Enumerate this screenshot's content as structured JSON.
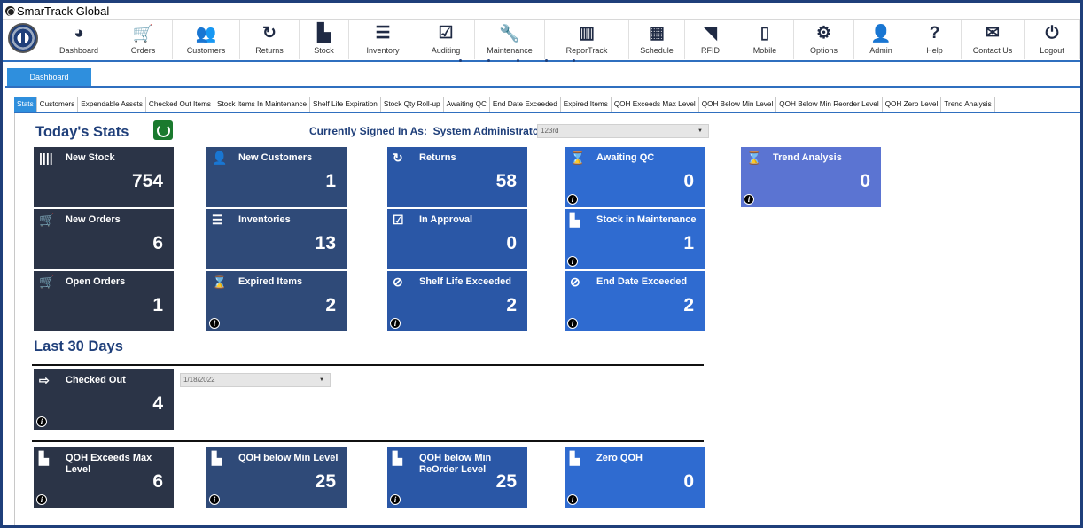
{
  "app": {
    "title": "SmarTrack Global"
  },
  "toolbar": {
    "items": [
      {
        "label": "Dashboard",
        "icon": "dashboard-icon",
        "glyph": "◕"
      },
      {
        "label": "Orders",
        "icon": "cart-icon",
        "glyph": "🛒"
      },
      {
        "label": "Customers",
        "icon": "users-icon",
        "glyph": "👥"
      },
      {
        "label": "Returns",
        "icon": "refresh-icon",
        "glyph": "↻"
      },
      {
        "label": "Stock",
        "icon": "stock-icon",
        "glyph": "▙"
      },
      {
        "label": "Inventory",
        "icon": "list-icon",
        "glyph": "☰"
      },
      {
        "label": "Auditing",
        "icon": "calendar-check-icon",
        "glyph": "☑"
      },
      {
        "label": "Maintenance",
        "icon": "wrench-icon",
        "glyph": "🔧"
      },
      {
        "label": "ReporTrack",
        "icon": "bar-chart-icon",
        "glyph": "▥"
      },
      {
        "label": "Schedule",
        "icon": "calendar-icon",
        "glyph": "▦"
      },
      {
        "label": "RFID",
        "icon": "rss-icon",
        "glyph": "◥"
      },
      {
        "label": "Mobile",
        "icon": "mobile-icon",
        "glyph": "▯"
      },
      {
        "label": "Options",
        "icon": "gears-icon",
        "glyph": "⚙"
      },
      {
        "label": "Admin",
        "icon": "user-icon",
        "glyph": "👤"
      },
      {
        "label": "Help",
        "icon": "help-icon",
        "glyph": "?"
      },
      {
        "label": "Contact Us",
        "icon": "envelope-icon",
        "glyph": "✉"
      },
      {
        "label": "Logout",
        "icon": "power-icon",
        "glyph": "⏻"
      }
    ]
  },
  "main_tab": "Dashboard",
  "subtabs": [
    "Stats",
    "Customers",
    "Expendable Assets",
    "Checked Out Items",
    "Stock Items In Maintenance",
    "Shelf Life Expiration",
    "Stock Qty Roll-up",
    "Awaiting QC",
    "End Date Exceeded",
    "Expired Items",
    "QOH Exceeds Max Level",
    "QOH Below Min Level",
    "QOH Below Min Reorder Level",
    "QOH Zero Level",
    "Trend Analysis"
  ],
  "stats": {
    "heading": "Today's Stats",
    "signed_in_label": "Currently Signed In As:",
    "signed_in_user": "System Administrator",
    "location_select": "123rd",
    "tiles": [
      {
        "title": "New Stock",
        "value": "754",
        "icon": "barcode-icon",
        "glyph": "||||",
        "info": false
      },
      {
        "title": "New Customers",
        "value": "1",
        "icon": "add-user-icon",
        "glyph": "👤",
        "info": false
      },
      {
        "title": "Returns",
        "value": "58",
        "icon": "refresh-icon",
        "glyph": "↻",
        "info": false
      },
      {
        "title": "Awaiting QC",
        "value": "0",
        "icon": "hourglass-icon",
        "glyph": "⌛",
        "info": true
      },
      {
        "title": "Trend Analysis",
        "value": "0",
        "icon": "hourglass-icon",
        "glyph": "⌛",
        "info": true
      },
      {
        "title": "New Orders",
        "value": "6",
        "icon": "cart-icon",
        "glyph": "🛒",
        "info": false
      },
      {
        "title": "Inventories",
        "value": "13",
        "icon": "list-icon",
        "glyph": "☰",
        "info": false
      },
      {
        "title": "In Approval",
        "value": "0",
        "icon": "checkbox-icon",
        "glyph": "☑",
        "info": false
      },
      {
        "title": "Stock in Maintenance",
        "value": "1",
        "icon": "stock-icon",
        "glyph": "▙",
        "info": true
      },
      {
        "title": "Open Orders",
        "value": "1",
        "icon": "cart-icon",
        "glyph": "🛒",
        "info": false
      },
      {
        "title": "Expired Items",
        "value": "2",
        "icon": "hourglass-icon",
        "glyph": "⌛",
        "info": true
      },
      {
        "title": "Shelf Life Exceeded",
        "value": "2",
        "icon": "ban-icon",
        "glyph": "⊘",
        "info": true
      },
      {
        "title": "End Date Exceeded",
        "value": "2",
        "icon": "ban-icon",
        "glyph": "⊘",
        "info": true
      }
    ]
  },
  "last30": {
    "heading": "Last 30 Days",
    "date_select": "1/18/2022",
    "checked_out": {
      "title": "Checked Out",
      "value": "4",
      "icon": "sign-out-icon",
      "glyph": "⇨"
    }
  },
  "qoh_tiles": [
    {
      "title": "QOH Exceeds Max Level",
      "value": "6",
      "icon": "stock-icon",
      "glyph": "▙"
    },
    {
      "title": "QOH below Min Level",
      "value": "25",
      "icon": "stock-icon",
      "glyph": "▙"
    },
    {
      "title": "QOH below Min ReOrder Level",
      "value": "25",
      "icon": "stock-icon",
      "glyph": "▙"
    },
    {
      "title": "Zero QOH",
      "value": "0",
      "icon": "stock-icon",
      "glyph": "▙"
    }
  ],
  "info_glyph": "i"
}
